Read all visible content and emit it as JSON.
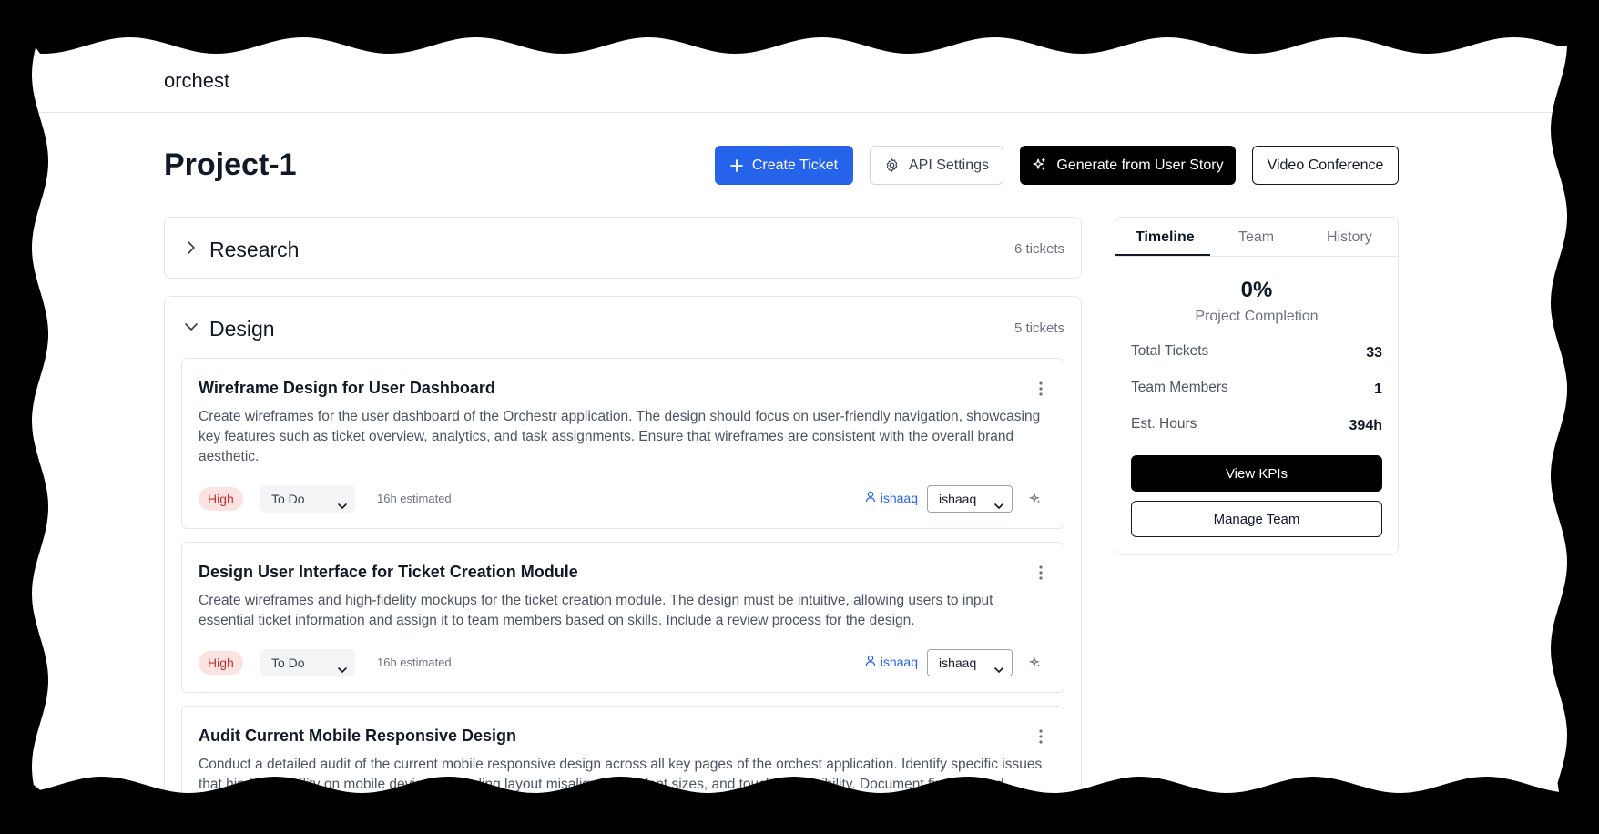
{
  "app": {
    "brand": "orchest"
  },
  "project": {
    "title": "Project-1"
  },
  "actions": {
    "create_ticket": "Create Ticket",
    "api_settings": "API Settings",
    "generate": "Generate from User Story",
    "video": "Video Conference"
  },
  "sections": [
    {
      "name": "Research",
      "count": "6 tickets",
      "expanded": false
    },
    {
      "name": "Design",
      "count": "5 tickets",
      "expanded": true
    }
  ],
  "tickets": [
    {
      "title": "Wireframe Design for User Dashboard",
      "description": "Create wireframes for the user dashboard of the Orchestr application. The design should focus on user-friendly navigation, showcasing key features such as ticket overview, analytics, and task assignments. Ensure that wireframes are consistent with the overall brand aesthetic.",
      "priority": "High",
      "status": "To Do",
      "estimate": "16h estimated",
      "assignee": "ishaaq",
      "assignee_select": "ishaaq"
    },
    {
      "title": "Design User Interface for Ticket Creation Module",
      "description": "Create wireframes and high-fidelity mockups for the ticket creation module. The design must be intuitive, allowing users to input essential ticket information and assign it to team members based on skills. Include a review process for the design.",
      "priority": "High",
      "status": "To Do",
      "estimate": "16h estimated",
      "assignee": "ishaaq",
      "assignee_select": "ishaaq"
    },
    {
      "title": "Audit Current Mobile Responsive Design",
      "description": "Conduct a detailed audit of the current mobile responsive design across all key pages of the orchest application. Identify specific issues that hinder usability on mobile devices, including layout misalignments, font sizes, and touch accessibility. Document findings and"
    }
  ],
  "panel": {
    "tabs": [
      "Timeline",
      "Team",
      "History"
    ],
    "active_tab": "Timeline",
    "completion_value": "0%",
    "completion_label": "Project Completion",
    "stats": [
      {
        "label": "Total Tickets",
        "value": "33"
      },
      {
        "label": "Team Members",
        "value": "1"
      },
      {
        "label": "Est. Hours",
        "value": "394h"
      }
    ],
    "view_kpis": "View KPIs",
    "manage_team": "Manage Team"
  },
  "colors": {
    "primary": "#2563eb",
    "black": "#000000",
    "priority_bg": "#fde2e2",
    "priority_text": "#c53030"
  }
}
